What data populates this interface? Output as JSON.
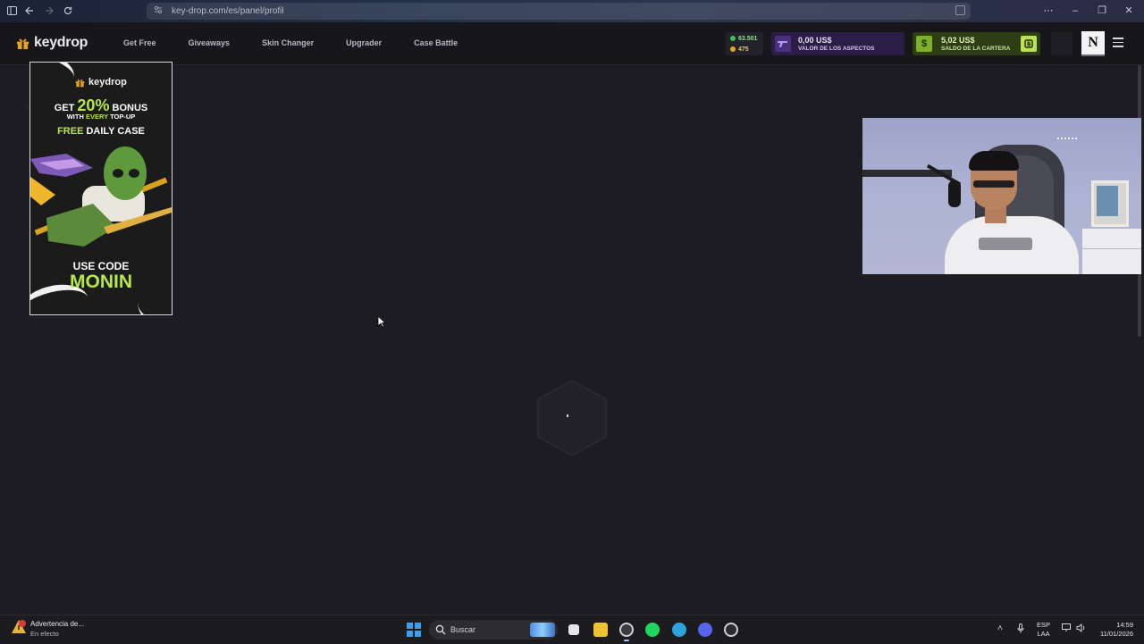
{
  "browser": {
    "url": "key-drop.com/es/panel/profil"
  },
  "header": {
    "logo_text": "keydrop",
    "nav": [
      "Get Free",
      "Giveaways",
      "Skin Changer",
      "Upgrader",
      "Case Battle"
    ],
    "counter_green": "63.501",
    "counter_gold": "475",
    "inventory_value": "0,00 US$",
    "inventory_label": "VALOR DE LOS ASPECTOS",
    "wallet_value": "5,02 US$",
    "wallet_label": "SALDO DE LA CARTERA",
    "avatar_letter": "N"
  },
  "ad": {
    "logo_text": "keydrop",
    "line1_prefix": "GET",
    "line1_percent": "20%",
    "line1_suffix": "BONUS",
    "line2_prefix": "WITH",
    "line2_em": "EVERY",
    "line2_suffix": "TOP-UP",
    "line3_em": "FREE",
    "line3_suffix": "DAILY CASE",
    "use_code": "USE CODE",
    "code": "MONIN"
  },
  "taskbar": {
    "notification_title": "Advertencia de...",
    "notification_sub": "En efecto",
    "search_placeholder": "Buscar",
    "lang_top": "ESP",
    "lang_bottom": "LAA",
    "time": "14:59",
    "date": "11/01/2026"
  },
  "colors": {
    "accent_green": "#b6e64a",
    "wallet_bg": "#2d3d14",
    "inventory_bg": "#2b1d46",
    "page_bg": "#1d1c22"
  }
}
